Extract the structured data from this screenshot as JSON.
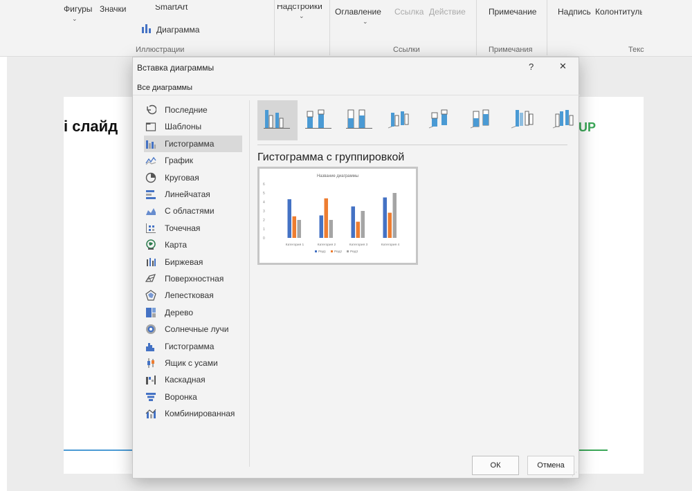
{
  "ribbon": {
    "figures": "Фигуры",
    "icons": "Значки",
    "smartart": "SmartArt",
    "chart": "Диаграмма",
    "illustrations_group": "Иллюстрации",
    "addins": "Надстройки",
    "toc": "Оглавление",
    "link": "Ссылка",
    "action": "Действие",
    "links_group": "Ссылки",
    "note": "Примечание",
    "notes_group": "Примечания",
    "textbox": "Надпись",
    "header_footer": "Колонтитулы",
    "text_group": "Текс"
  },
  "slide": {
    "title_fragment": "і слайд",
    "logo_fragment": "UP"
  },
  "dialog": {
    "title": "Вставка диаграммы",
    "help": "?",
    "close": "✕",
    "tab": "Все диаграммы",
    "selected_subtype_title": "Гистограмма с группировкой",
    "ok": "ОК",
    "cancel": "Отмена",
    "nav_items": [
      {
        "label": "Последние",
        "icon": "recent-icon"
      },
      {
        "label": "Шаблоны",
        "icon": "templates-icon"
      },
      {
        "label": "Гистограмма",
        "icon": "column-chart-icon",
        "selected": true
      },
      {
        "label": "График",
        "icon": "line-chart-icon"
      },
      {
        "label": "Круговая",
        "icon": "pie-chart-icon"
      },
      {
        "label": "Линейчатая",
        "icon": "bar-chart-icon"
      },
      {
        "label": "С областями",
        "icon": "area-chart-icon"
      },
      {
        "label": "Точечная",
        "icon": "scatter-chart-icon"
      },
      {
        "label": "Карта",
        "icon": "map-chart-icon"
      },
      {
        "label": "Биржевая",
        "icon": "stock-chart-icon"
      },
      {
        "label": "Поверхностная",
        "icon": "surface-chart-icon"
      },
      {
        "label": "Лепестковая",
        "icon": "radar-chart-icon"
      },
      {
        "label": "Дерево",
        "icon": "treemap-chart-icon"
      },
      {
        "label": "Солнечные лучи",
        "icon": "sunburst-chart-icon"
      },
      {
        "label": "Гистограмма",
        "icon": "histogram-chart-icon"
      },
      {
        "label": "Ящик с усами",
        "icon": "box-whisker-chart-icon"
      },
      {
        "label": "Каскадная",
        "icon": "waterfall-chart-icon"
      },
      {
        "label": "Воронка",
        "icon": "funnel-chart-icon"
      },
      {
        "label": "Комбинированная",
        "icon": "combo-chart-icon"
      }
    ]
  },
  "colors": {
    "series1": "#4472c4",
    "series2": "#ed7d31",
    "series3": "#a5a5a5",
    "accent_blue": "#4a9ad4",
    "logo_green": "#3aa757"
  },
  "chart_data": {
    "type": "bar",
    "title": "Название диаграммы",
    "categories": [
      "Категория 1",
      "Категория 2",
      "Категория 3",
      "Категория 4"
    ],
    "series": [
      {
        "name": "Ряд1",
        "values": [
          4.3,
          2.5,
          3.5,
          4.5
        ]
      },
      {
        "name": "Ряд2",
        "values": [
          2.4,
          4.4,
          1.8,
          2.8
        ]
      },
      {
        "name": "Ряд3",
        "values": [
          2,
          2,
          3,
          5
        ]
      }
    ],
    "yticks": [
      "0",
      "1",
      "2",
      "3",
      "4",
      "5",
      "6"
    ],
    "ylim": [
      0,
      6
    ],
    "legend": "bottom",
    "grid": false
  }
}
